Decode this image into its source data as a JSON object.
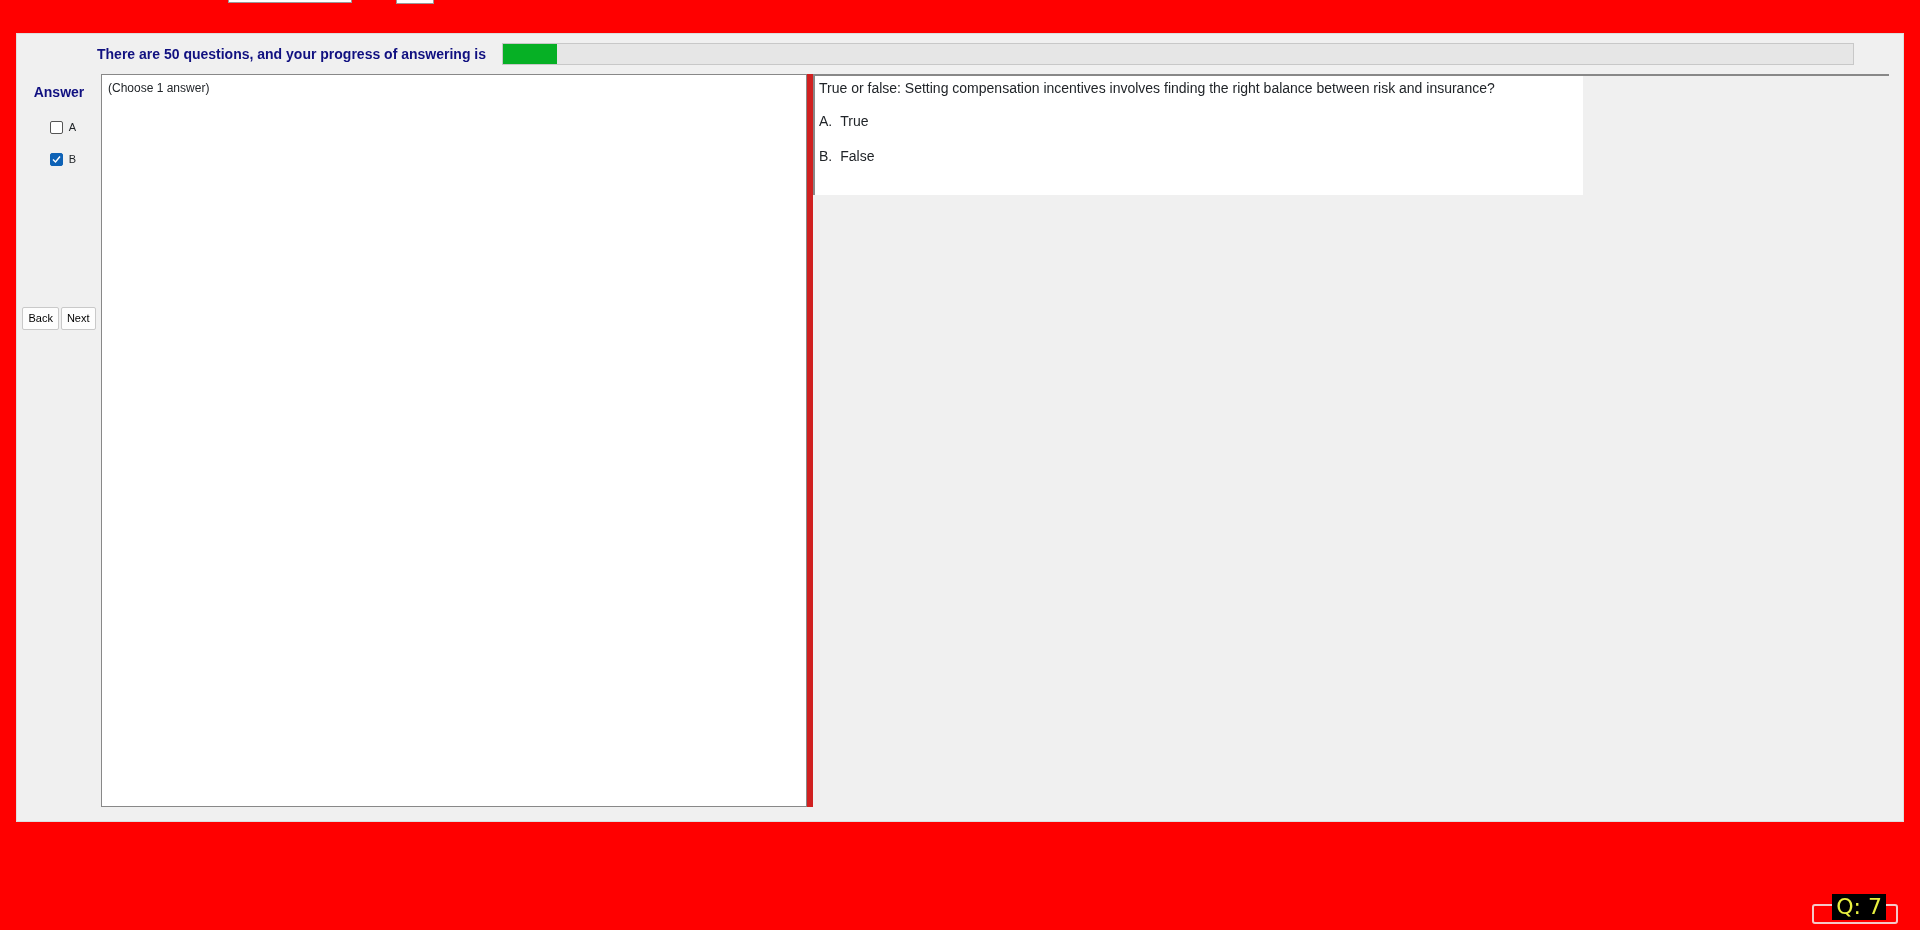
{
  "progress": {
    "label": "There are 50 questions, and your progress of answering is",
    "level": 0.04
  },
  "answer_panel": {
    "title": "Answer",
    "options": [
      {
        "label": "A",
        "checked": false
      },
      {
        "label": "B",
        "checked": true
      }
    ],
    "buttons": [
      "Back",
      "Next"
    ]
  },
  "answer_area": {
    "hint": "(Choose 1 answer)"
  },
  "question": {
    "text": "True or false: Setting compensation incentives involves finding the right balance between risk and insurance?",
    "choices": [
      {
        "letter": "A.",
        "text": "True"
      },
      {
        "letter": "B.",
        "text": "False"
      }
    ]
  },
  "question_counter": "Q: 7"
}
